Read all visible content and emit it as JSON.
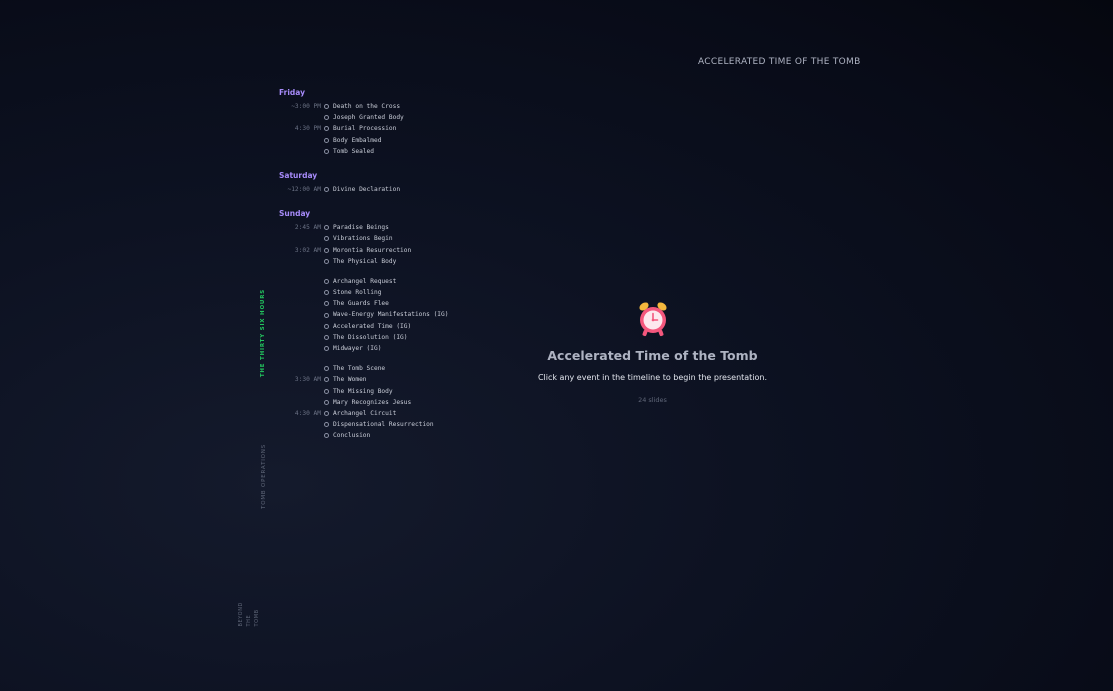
{
  "header": {
    "title": "ACCELERATED TIME OF THE TOMB"
  },
  "sections": {
    "active": "THE THIRTY SIX HOURS",
    "ops": "TOMB OPERATIONS",
    "beyond": [
      "BEYOND",
      "THE",
      "TOMB"
    ]
  },
  "timeline": {
    "friday": {
      "title": "Friday",
      "events": [
        {
          "time": "~3:00 PM",
          "label": "Death on the Cross"
        },
        {
          "time": "",
          "label": "Joseph Granted Body"
        },
        {
          "time": "4:30 PM",
          "label": "Burial Procession"
        },
        {
          "time": "",
          "label": "Body Embalmed"
        },
        {
          "time": "",
          "label": "Tomb Sealed"
        }
      ]
    },
    "saturday": {
      "title": "Saturday",
      "events": [
        {
          "time": "~12:00 AM",
          "label": "Divine Declaration"
        }
      ]
    },
    "sunday": {
      "title": "Sunday",
      "group1": [
        {
          "time": "2:45 AM",
          "label": "Paradise Beings"
        },
        {
          "time": "",
          "label": "Vibrations Begin"
        },
        {
          "time": "3:02 AM",
          "label": "Morontia Resurrection"
        },
        {
          "time": "",
          "label": "The Physical Body"
        }
      ],
      "group2": [
        {
          "time": "",
          "label": "Archangel Request"
        },
        {
          "time": "",
          "label": "Stone Rolling"
        },
        {
          "time": "",
          "label": "The Guards Flee"
        },
        {
          "time": "",
          "label": "Wave-Energy Manifestations (IG)"
        },
        {
          "time": "",
          "label": "Accelerated Time (IG)"
        },
        {
          "time": "",
          "label": "The Dissolution (IG)"
        },
        {
          "time": "",
          "label": "Midwayer (IG)"
        }
      ],
      "group3": [
        {
          "time": "",
          "label": "The Tomb Scene"
        },
        {
          "time": "3:30 AM",
          "label": "The Women"
        },
        {
          "time": "",
          "label": "The Missing Body"
        },
        {
          "time": "",
          "label": "Mary Recognizes Jesus"
        },
        {
          "time": "4:30 AM",
          "label": "Archangel Circuit"
        },
        {
          "time": "",
          "label": "Dispensational Resurrection"
        },
        {
          "time": "",
          "label": "Conclusion"
        }
      ]
    }
  },
  "center": {
    "icon": "alarm-clock-icon",
    "title": "Accelerated Time of the Tomb",
    "subtitle": "Click any event in the timeline to begin the presentation.",
    "count": "24 slides"
  },
  "colors": {
    "day_title": "#a78bfa",
    "active_section": "#22c55e",
    "clock_body": "#f4577d",
    "clock_bells": "#f5b83d"
  }
}
